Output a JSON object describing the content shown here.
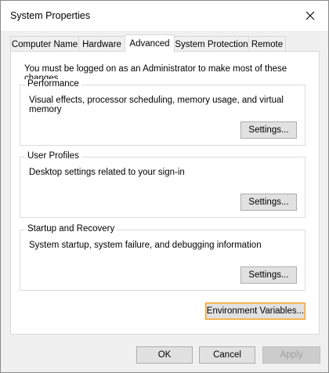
{
  "window": {
    "title": "System Properties"
  },
  "tabs": [
    {
      "label": "Computer Name",
      "active": false
    },
    {
      "label": "Hardware",
      "active": false
    },
    {
      "label": "Advanced",
      "active": true
    },
    {
      "label": "System Protection",
      "active": false
    },
    {
      "label": "Remote",
      "active": false
    }
  ],
  "advanced": {
    "admin_note": "You must be logged on as an Administrator to make most of these changes.",
    "performance": {
      "legend": "Performance",
      "description": "Visual effects, processor scheduling, memory usage, and virtual memory",
      "button": "Settings..."
    },
    "user_profiles": {
      "legend": "User Profiles",
      "description": "Desktop settings related to your sign-in",
      "button": "Settings..."
    },
    "startup_recovery": {
      "legend": "Startup and Recovery",
      "description": "System startup, system failure, and debugging information",
      "button": "Settings..."
    },
    "env_button": "Environment Variables..."
  },
  "footer": {
    "ok": "OK",
    "cancel": "Cancel",
    "apply": "Apply"
  },
  "icons": {
    "close": "close-icon"
  },
  "colors": {
    "focus_border": "#f0a12b",
    "window_bg": "#f0f0f0",
    "panel_bg": "#ffffff"
  }
}
